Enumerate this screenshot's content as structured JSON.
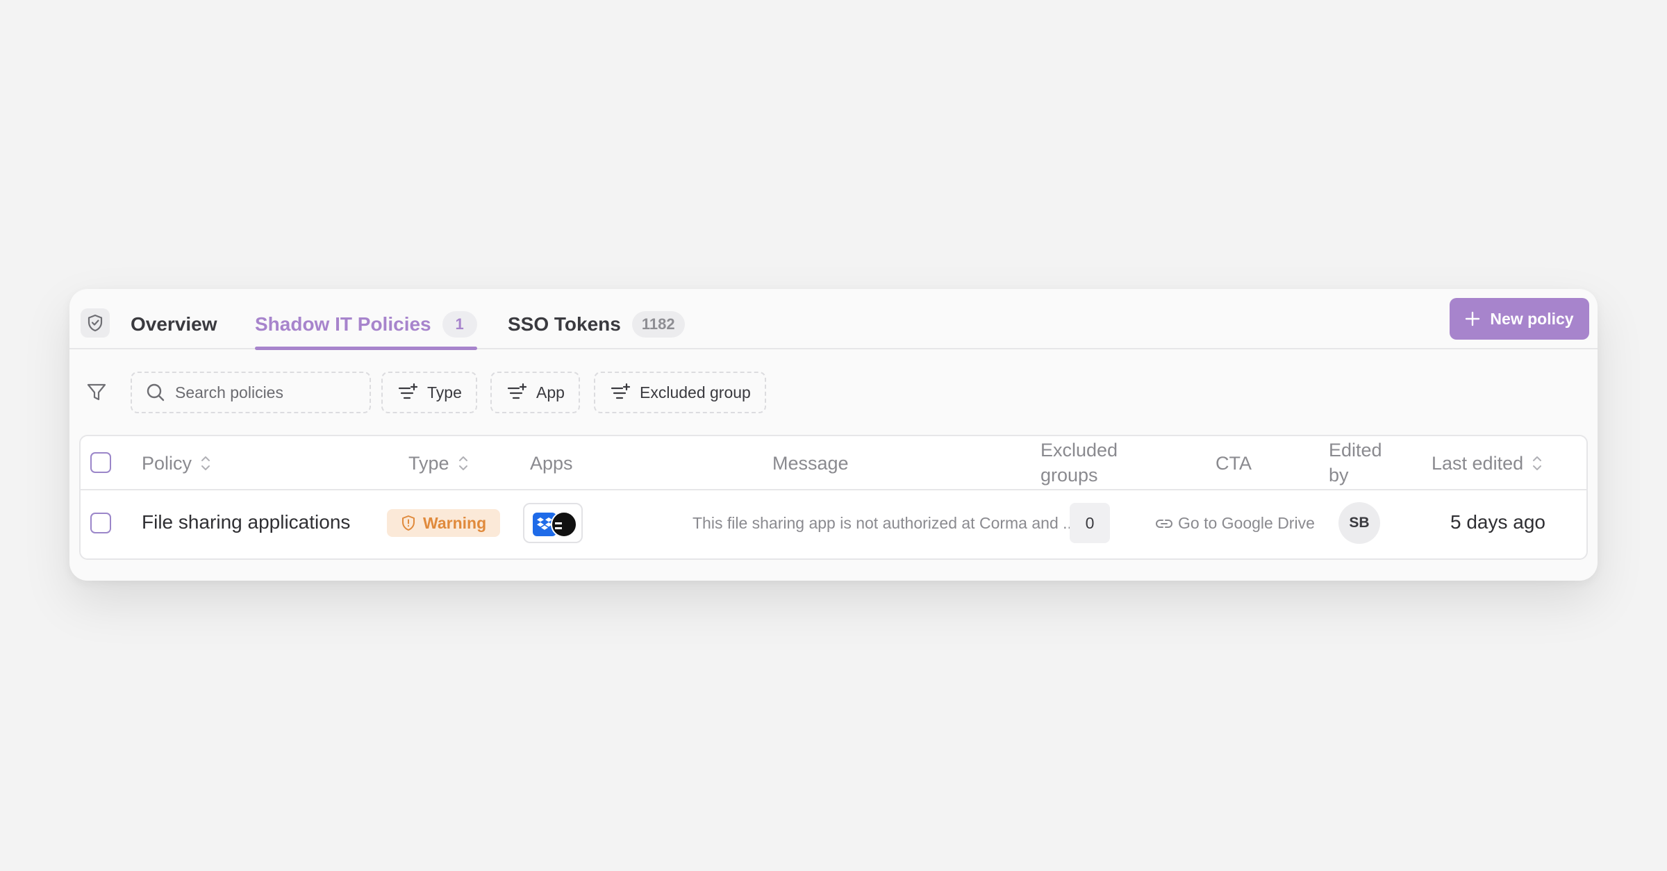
{
  "tabs": [
    {
      "label": "Overview"
    },
    {
      "label": "Shadow IT Policies",
      "count": "1"
    },
    {
      "label": "SSO Tokens",
      "count": "1182"
    }
  ],
  "header": {
    "new_policy_label": "New policy"
  },
  "filters": {
    "search_placeholder": "Search policies",
    "chips": [
      "Type",
      "App",
      "Excluded group"
    ]
  },
  "table": {
    "columns": {
      "policy": "Policy",
      "type": "Type",
      "apps": "Apps",
      "message": "Message",
      "excluded_line1": "Excluded",
      "excluded_line2": "groups",
      "cta": "CTA",
      "edited_line1": "Edited",
      "edited_line2": "by",
      "last_edited": "Last edited"
    },
    "rows": [
      {
        "policy": "File sharing applications",
        "type": "Warning",
        "apps": [
          "dropbox-icon",
          "app-icon"
        ],
        "message": "This file sharing app is not authorized at Corma and ...",
        "excluded_groups": "0",
        "cta": "Go to Google Drive",
        "edited_by": "SB",
        "last_edited": "5 days ago"
      }
    ]
  },
  "colors": {
    "accent": "#a784cc",
    "warning_bg": "#fbe9d8",
    "warning_text": "#e08a3c",
    "dropbox": "#1f6be8"
  }
}
